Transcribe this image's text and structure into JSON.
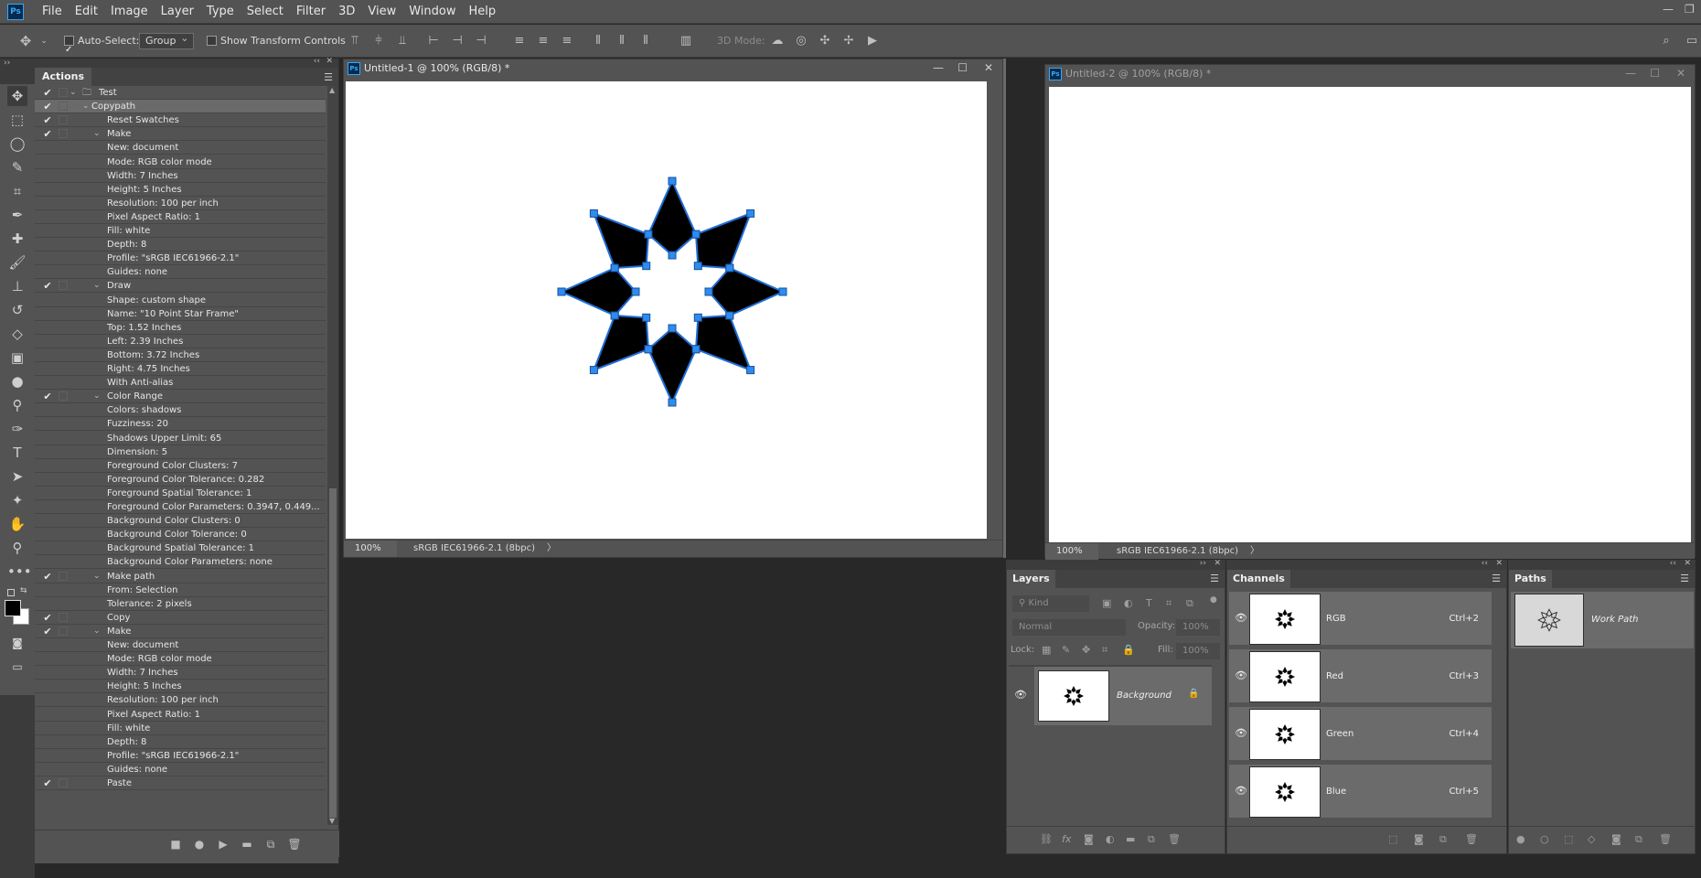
{
  "app": {
    "logo": "Ps"
  },
  "menubar": {
    "items": [
      "File",
      "Edit",
      "Image",
      "Layer",
      "Type",
      "Select",
      "Filter",
      "3D",
      "View",
      "Window",
      "Help"
    ]
  },
  "options_bar": {
    "auto_select_label": "Auto-Select:",
    "auto_select_checked": true,
    "auto_select_value": "Group",
    "show_transform_label": "Show Transform Controls",
    "mode_3d_label": "3D Mode:"
  },
  "actions_panel": {
    "tab": "Actions",
    "rows": [
      {
        "check": true,
        "indent": 0,
        "toggle": "open",
        "folder": true,
        "text": "Test",
        "selected": false
      },
      {
        "check": true,
        "indent": 1,
        "toggle": "open",
        "text": "Copypath",
        "selected": true
      },
      {
        "check": true,
        "indent": 2,
        "toggle": "",
        "text": "Reset Swatches"
      },
      {
        "check": true,
        "indent": 2,
        "toggle": "open",
        "text": "Make"
      },
      {
        "check": false,
        "indent": 3,
        "text": "New: document"
      },
      {
        "check": false,
        "indent": 3,
        "text": "Mode: RGB color mode"
      },
      {
        "check": false,
        "indent": 3,
        "text": "Width: 7 Inches"
      },
      {
        "check": false,
        "indent": 3,
        "text": "Height: 5 Inches"
      },
      {
        "check": false,
        "indent": 3,
        "text": "Resolution: 100 per inch"
      },
      {
        "check": false,
        "indent": 3,
        "text": "Pixel Aspect Ratio: 1"
      },
      {
        "check": false,
        "indent": 3,
        "text": "Fill: white"
      },
      {
        "check": false,
        "indent": 3,
        "text": "Depth: 8"
      },
      {
        "check": false,
        "indent": 3,
        "text": "Profile:  \"sRGB IEC61966-2.1\""
      },
      {
        "check": false,
        "indent": 3,
        "text": "Guides: none"
      },
      {
        "check": true,
        "indent": 2,
        "toggle": "open",
        "text": "Draw"
      },
      {
        "check": false,
        "indent": 3,
        "text": "Shape: custom shape"
      },
      {
        "check": false,
        "indent": 3,
        "text": "Name:  \"10 Point Star Frame\""
      },
      {
        "check": false,
        "indent": 3,
        "text": "Top: 1.52 Inches"
      },
      {
        "check": false,
        "indent": 3,
        "text": "Left: 2.39 Inches"
      },
      {
        "check": false,
        "indent": 3,
        "text": "Bottom: 3.72 Inches"
      },
      {
        "check": false,
        "indent": 3,
        "text": "Right: 4.75 Inches"
      },
      {
        "check": false,
        "indent": 3,
        "text": "With Anti-alias"
      },
      {
        "check": true,
        "indent": 2,
        "toggle": "open",
        "text": "Color Range"
      },
      {
        "check": false,
        "indent": 3,
        "text": "Colors: shadows"
      },
      {
        "check": false,
        "indent": 3,
        "text": "Fuzziness: 20"
      },
      {
        "check": false,
        "indent": 3,
        "text": "Shadows Upper Limit: 65"
      },
      {
        "check": false,
        "indent": 3,
        "text": "Dimension: 5"
      },
      {
        "check": false,
        "indent": 3,
        "text": "Foreground Color Clusters: 7"
      },
      {
        "check": false,
        "indent": 3,
        "text": "Foreground Color Tolerance: 0.282"
      },
      {
        "check": false,
        "indent": 3,
        "text": "Foreground Spatial Tolerance: 1"
      },
      {
        "check": false,
        "indent": 3,
        "text": "Foreground Color Parameters: 0.3947, 0.449..."
      },
      {
        "check": false,
        "indent": 3,
        "text": "Background Color Clusters: 0"
      },
      {
        "check": false,
        "indent": 3,
        "text": "Background Color Tolerance: 0"
      },
      {
        "check": false,
        "indent": 3,
        "text": "Background Spatial Tolerance: 1"
      },
      {
        "check": false,
        "indent": 3,
        "text": "Background Color Parameters: none"
      },
      {
        "check": true,
        "indent": 2,
        "toggle": "open",
        "text": "Make path"
      },
      {
        "check": false,
        "indent": 3,
        "text": "From: Selection"
      },
      {
        "check": false,
        "indent": 3,
        "text": "Tolerance: 2 pixels"
      },
      {
        "check": true,
        "indent": 2,
        "toggle": "",
        "text": "Copy"
      },
      {
        "check": true,
        "indent": 2,
        "toggle": "open",
        "text": "Make"
      },
      {
        "check": false,
        "indent": 3,
        "text": "New: document"
      },
      {
        "check": false,
        "indent": 3,
        "text": "Mode: RGB color mode"
      },
      {
        "check": false,
        "indent": 3,
        "text": "Width: 7 Inches"
      },
      {
        "check": false,
        "indent": 3,
        "text": "Height: 5 Inches"
      },
      {
        "check": false,
        "indent": 3,
        "text": "Resolution: 100 per inch"
      },
      {
        "check": false,
        "indent": 3,
        "text": "Pixel Aspect Ratio: 1"
      },
      {
        "check": false,
        "indent": 3,
        "text": "Fill: white"
      },
      {
        "check": false,
        "indent": 3,
        "text": "Depth: 8"
      },
      {
        "check": false,
        "indent": 3,
        "text": "Profile:  \"sRGB IEC61966-2.1\""
      },
      {
        "check": false,
        "indent": 3,
        "text": "Guides: none"
      },
      {
        "check": true,
        "indent": 2,
        "toggle": "",
        "text": "Paste"
      }
    ]
  },
  "doc1": {
    "title": "Untitled-1 @ 100% (RGB/8) *",
    "zoom": "100%",
    "profile": "sRGB IEC61966-2.1 (8bpc)"
  },
  "doc2": {
    "title": "Untitled-2 @ 100% (RGB/8) *",
    "zoom": "100%",
    "profile": "sRGB IEC61966-2.1 (8bpc)"
  },
  "layers_panel": {
    "tab": "Layers",
    "kind_placeholder": "Kind",
    "blend_mode": "Normal",
    "opacity_label": "Opacity:",
    "opacity_value": "100%",
    "lock_label": "Lock:",
    "fill_label": "Fill:",
    "fill_value": "100%",
    "layer_name": "Background"
  },
  "channels_panel": {
    "tab": "Channels",
    "channels": [
      {
        "name": "RGB",
        "shortcut": "Ctrl+2"
      },
      {
        "name": "Red",
        "shortcut": "Ctrl+3"
      },
      {
        "name": "Green",
        "shortcut": "Ctrl+4"
      },
      {
        "name": "Blue",
        "shortcut": "Ctrl+5"
      }
    ]
  },
  "paths_panel": {
    "tab": "Paths",
    "path_name": "Work Path"
  },
  "colors": {
    "path_blue": "#1f6fd6",
    "anchor_blue": "#2d8cf0",
    "ui_gray": "#535353",
    "selected_row": "#6a6a6a"
  }
}
